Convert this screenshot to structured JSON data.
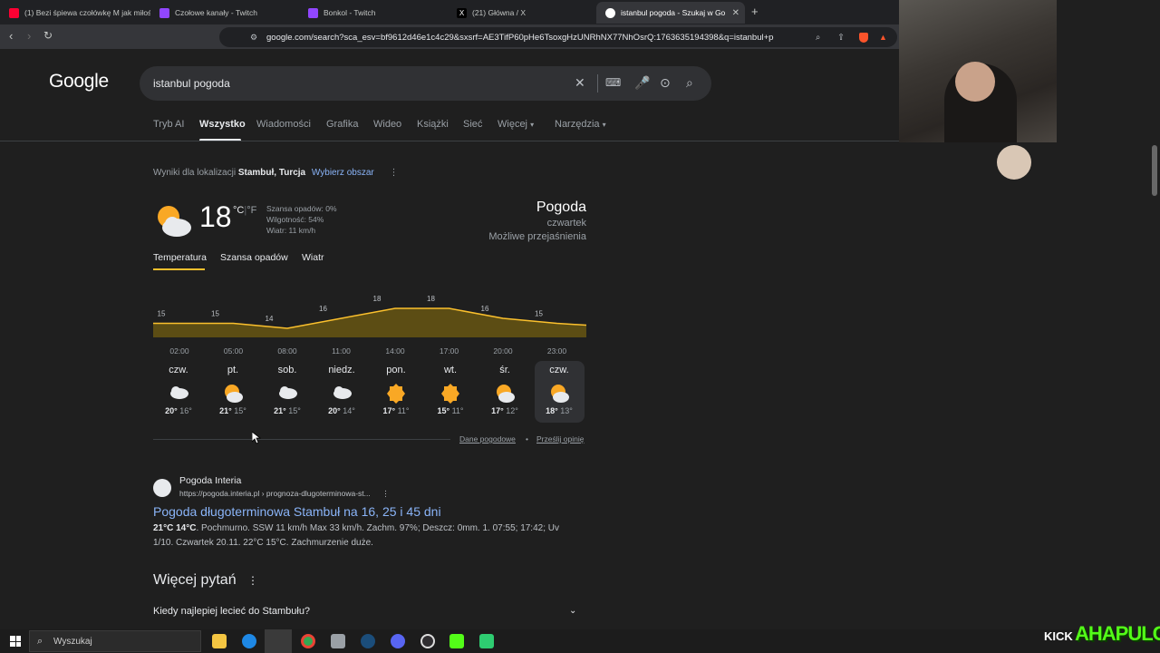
{
  "browser": {
    "tabs": [
      {
        "label": "(1) Bezi śpiewa czołówkę M jak miłoś",
        "fav_color": "#ff0033"
      },
      {
        "label": "Czołowe kanały - Twitch",
        "fav_color": "#9146ff"
      },
      {
        "label": "Bonkol - Twitch",
        "fav_color": "#9146ff"
      },
      {
        "label": "(21) Główna / X",
        "fav_color": "#000000"
      },
      {
        "label": "istanbul pogoda - Szukaj w Goo",
        "fav_color": "#ffffff"
      }
    ],
    "new_tab": "+",
    "url": "google.com/search?sca_esv=bf9612d46e1c4c29&sxsrf=AE3TifP60pHe6TsoxgHzUNRhNX77NhOsrQ:1763635194398&q=istanbul+pogoda&spel..."
  },
  "google": {
    "logo": "Google",
    "query": "istanbul pogoda",
    "nav_tabs": [
      "Tryb AI",
      "Wszystko",
      "Wiadomości",
      "Grafika",
      "Wideo",
      "Książki",
      "Sieć",
      "Więcej",
      "Narzędzia"
    ],
    "location_prefix": "Wyniki dla lokalizacji",
    "location": "Stambuł, Turcja",
    "location_link": "Wybierz obszar"
  },
  "weather": {
    "temp": "18",
    "unit_c": "°C",
    "unit_sep": "|",
    "unit_f": "°F",
    "precip": "Szansa opadów: 0%",
    "humidity": "Wilgotność: 54%",
    "wind": "Wiatr: 11 km/h",
    "title": "Pogoda",
    "day": "czwartek",
    "condition": "Możliwe przejaśnienia",
    "tabs": [
      "Temperatura",
      "Szansa opadów",
      "Wiatr"
    ],
    "hour_labels": [
      "02:00",
      "05:00",
      "08:00",
      "11:00",
      "14:00",
      "17:00",
      "20:00",
      "23:00"
    ],
    "hour_temps": [
      15,
      15,
      14,
      16,
      18,
      18,
      16,
      15
    ],
    "days": [
      {
        "name": "czw.",
        "hi": "20°",
        "lo": "16°",
        "icon": "cloud-icon"
      },
      {
        "name": "pt.",
        "hi": "21°",
        "lo": "15°",
        "icon": "partly-sunny-icon"
      },
      {
        "name": "sob.",
        "hi": "21°",
        "lo": "15°",
        "icon": "cloud-icon"
      },
      {
        "name": "niedz.",
        "hi": "20°",
        "lo": "14°",
        "icon": "cloud-icon"
      },
      {
        "name": "pon.",
        "hi": "17°",
        "lo": "11°",
        "icon": "sun-icon"
      },
      {
        "name": "wt.",
        "hi": "15°",
        "lo": "11°",
        "icon": "sun-icon"
      },
      {
        "name": "śr.",
        "hi": "17°",
        "lo": "12°",
        "icon": "partly-sunny-icon"
      },
      {
        "name": "czw.",
        "hi": "18°",
        "lo": "13°",
        "icon": "partly-sunny-icon"
      }
    ],
    "footer_link1": "Dane pogodowe",
    "footer_sep": "•",
    "footer_link2": "Prześlij opinię"
  },
  "result": {
    "site": "Pogoda Interia",
    "url": "https://pogoda.interia.pl › prognoza-dlugoterminowa-st...",
    "title": "Pogoda długoterminowa Stambuł na 16, 25 i 45 dni",
    "snippet_bold": "21°C 14°C",
    "snippet_line1": ". Pochmurno. SSW 11 km/h Max 33 km/h. Zachm. 97%; Deszcz: 0mm. 1. 07:55; 17:42; Uv",
    "snippet_line2": "1/10. Czwartek 20.11. 22°C 15°C. Zachmurzenie duże."
  },
  "questions": {
    "title": "Więcej pytań",
    "q1": "Kiedy najlepiej lecieć do Stambułu?"
  },
  "taskbar": {
    "search": "Wyszukaj"
  },
  "overlay": {
    "kick": "KICK",
    "brand": "AHAPULCO"
  },
  "colors": {
    "accent_blue": "#8ab4f8",
    "chart_fill": "#5c4d14",
    "chart_line": "#fbc02d",
    "sun": "#f9a825",
    "brand_green": "#53fc18"
  }
}
